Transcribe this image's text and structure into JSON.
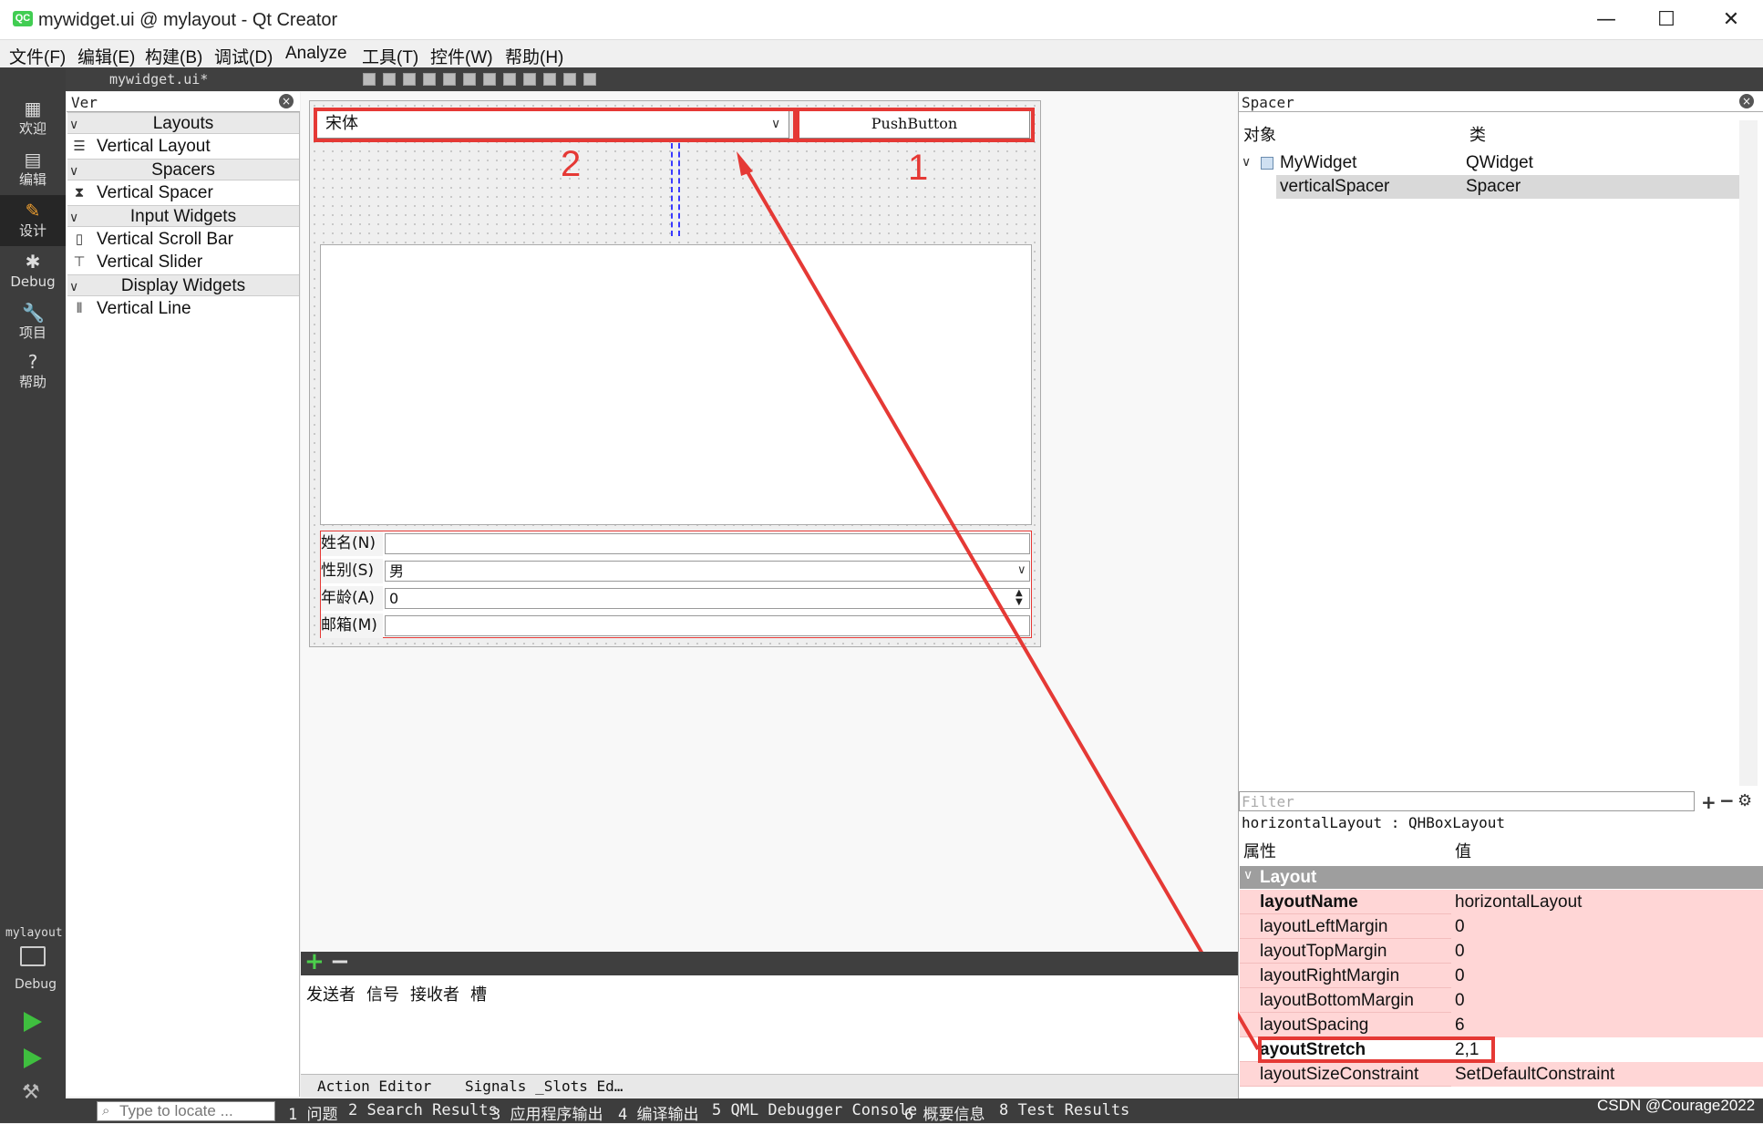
{
  "window": {
    "title": "mywidget.ui @ mylayout - Qt Creator",
    "app_icon": "QC",
    "minimize": "—",
    "maximize": "☐",
    "close": "✕"
  },
  "menu": [
    "文件(F)",
    "编辑(E)",
    "构建(B)",
    "调试(D)",
    "Analyze",
    "工具(T)",
    "控件(W)",
    "帮助(H)"
  ],
  "modes": [
    {
      "label": "欢迎",
      "icon": "grid-icon"
    },
    {
      "label": "编辑",
      "icon": "edit-doc-icon"
    },
    {
      "label": "设计",
      "icon": "pencil-icon"
    },
    {
      "label": "Debug",
      "icon": "bug-icon"
    },
    {
      "label": "项目",
      "icon": "wrench-icon"
    },
    {
      "label": "帮助",
      "icon": "help-icon"
    }
  ],
  "kit": {
    "project": "mylayout",
    "config": "Debug"
  },
  "editor": {
    "tab": "mywidget.ui*"
  },
  "widget_box": {
    "filter": "Ver",
    "categories": [
      {
        "name": "Layouts",
        "items": [
          "Vertical Layout"
        ]
      },
      {
        "name": "Spacers",
        "items": [
          "Vertical Spacer"
        ]
      },
      {
        "name": "Input Widgets",
        "items": [
          "Vertical Scroll Bar",
          "Vertical Slider"
        ]
      },
      {
        "name": "Display Widgets",
        "items": [
          "Vertical Line"
        ]
      }
    ]
  },
  "form": {
    "combo_font": "宋体",
    "push_button": "PushButton",
    "annotation_1": "1",
    "annotation_2": "2",
    "rows": [
      {
        "label": "姓名(N)",
        "value": ""
      },
      {
        "label": "性别(S)",
        "value": "男"
      },
      {
        "label": "年龄(A)",
        "value": "0"
      },
      {
        "label": "邮箱(M)",
        "value": ""
      }
    ]
  },
  "object_inspector": {
    "filter": "Spacer",
    "col_object": "对象",
    "col_class": "类",
    "rows": [
      {
        "object": "MyWidget",
        "class": "QWidget"
      },
      {
        "object": "verticalSpacer",
        "class": "Spacer"
      }
    ]
  },
  "property_editor": {
    "filter_placeholder": "Filter",
    "object": "horizontalLayout : QHBoxLayout",
    "col_property": "属性",
    "col_value": "值",
    "category": "Layout",
    "rows": [
      {
        "name": "layoutName",
        "value": "horizontalLayout"
      },
      {
        "name": "layoutLeftMargin",
        "value": "0"
      },
      {
        "name": "layoutTopMargin",
        "value": "0"
      },
      {
        "name": "layoutRightMargin",
        "value": "0"
      },
      {
        "name": "layoutBottomMargin",
        "value": "0"
      },
      {
        "name": "layoutSpacing",
        "value": "6"
      },
      {
        "name": "ayoutStretch",
        "value": "2,1"
      },
      {
        "name": "layoutSizeConstraint",
        "value": "SetDefaultConstraint"
      }
    ]
  },
  "signal_slot": {
    "columns": [
      "发送者",
      "信号",
      "接收者",
      "槽"
    ]
  },
  "bottom_tabs": [
    "Action Editor",
    "Signals _Slots Ed…"
  ],
  "status": {
    "locator_placeholder": "Type to locate ...",
    "panes": [
      "1 问题",
      "2 Search Results",
      "3 应用程序输出",
      "4 编译输出",
      "5 QML Debugger Console",
      "6 概要信息",
      "8 Test Results"
    ],
    "watermark": "CSDN @Courage2022"
  },
  "colors": {
    "annotation_red": "#e53935",
    "property_bg": "#ffd6d6",
    "mode_bar": "#3d3d3d"
  }
}
